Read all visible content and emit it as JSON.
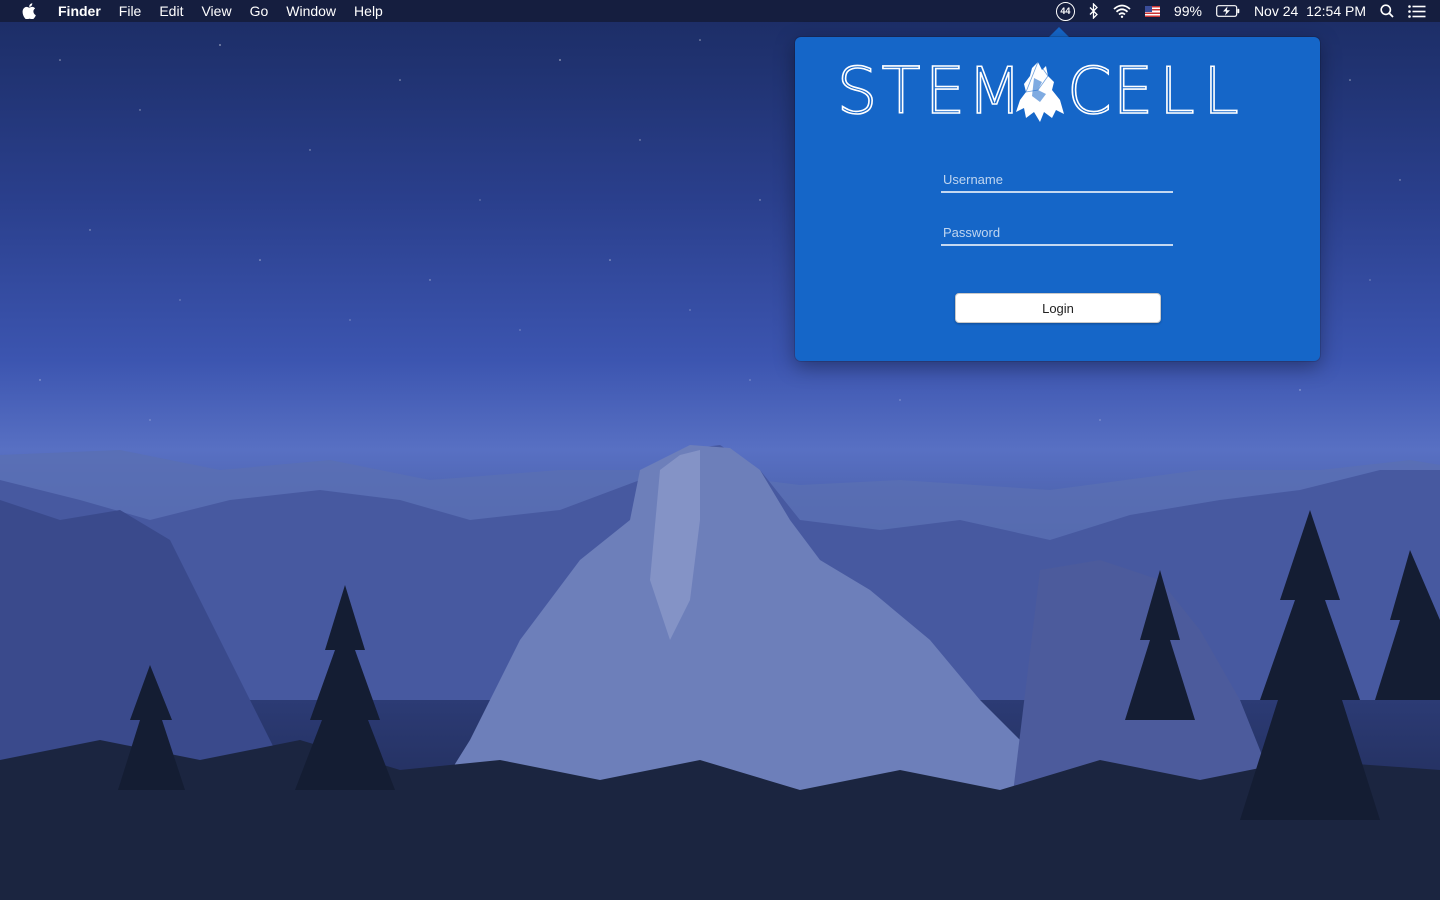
{
  "menubar": {
    "apple_icon": "apple-icon",
    "items": [
      "Finder",
      "File",
      "Edit",
      "View",
      "Go",
      "Window",
      "Help"
    ],
    "status": {
      "badge": "44",
      "battery_percent": "99%",
      "datetime": "Nov 24  12:54 PM"
    }
  },
  "popover": {
    "logo_letters_left": [
      "S",
      "T",
      "E",
      "M"
    ],
    "logo_letters_right": [
      "C",
      "E",
      "L",
      "L"
    ],
    "username": {
      "placeholder": "Username",
      "value": ""
    },
    "password": {
      "placeholder": "Password",
      "value": ""
    },
    "login_label": "Login"
  },
  "colors": {
    "popover_bg": "#1566c8",
    "menubar_bg": "#141c3a",
    "button_bg": "#ffffff"
  }
}
